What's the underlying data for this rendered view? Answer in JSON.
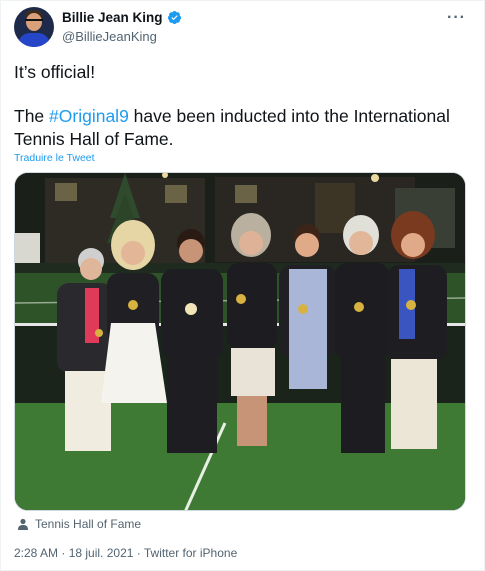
{
  "author": {
    "display_name": "Billie Jean King",
    "handle": "@BillieJeanKing",
    "verified": true,
    "avatar_icon": "profile-photo"
  },
  "menu_icon": "more-dots-icon",
  "tweet": {
    "line1": "It’s official!",
    "line2_before": "The ",
    "hashtag": "#Original9",
    "line2_after": " have been inducted into the International Tennis Hall of Fame.",
    "translate_label": "Traduire le Tweet"
  },
  "media": {
    "alt": "Photo of the Original 9 wearing medals at the International Tennis Hall of Fame"
  },
  "location": {
    "icon": "person-icon",
    "label": "Tennis Hall of Fame"
  },
  "meta": {
    "time": "2:28 AM",
    "separator1": " · ",
    "date": "18 juil. 2021",
    "separator2": " · ",
    "source": "Twitter for iPhone"
  },
  "colors": {
    "link": "#1d9bf0",
    "secondary_text": "#536471",
    "verified_badge": "#1d9bf0"
  }
}
